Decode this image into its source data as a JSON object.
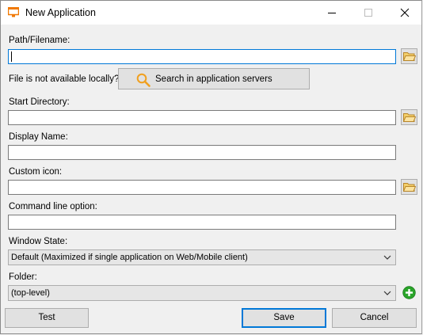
{
  "window": {
    "title": "New Application"
  },
  "fields": {
    "path_label": "Path/Filename:",
    "path_value": "",
    "not_local_label": "File is not available locally?",
    "search_button": "Search in application servers",
    "start_dir_label": "Start Directory:",
    "start_dir_value": "",
    "display_name_label": "Display Name:",
    "display_name_value": "",
    "custom_icon_label": "Custom icon:",
    "custom_icon_value": "",
    "cmdline_label": "Command line option:",
    "cmdline_value": "",
    "window_state_label": "Window State:",
    "window_state_value": "Default (Maximized if single application on Web/Mobile client)",
    "folder_label": "Folder:",
    "folder_value": "(top-level)"
  },
  "buttons": {
    "test": "Test",
    "save": "Save",
    "cancel": "Cancel"
  },
  "icons": {
    "app": "app-window-icon",
    "folder": "folder-open-icon",
    "search": "magnifier-icon",
    "add": "plus-circle-icon"
  },
  "colors": {
    "focus": "#0078d7",
    "folder": "#e8b84a",
    "search": "#f0a020",
    "add": "#2aa52a"
  }
}
